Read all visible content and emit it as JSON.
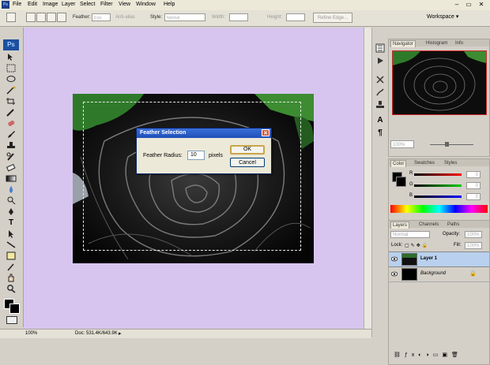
{
  "menubar": {
    "items": [
      "File",
      "Edit",
      "Image",
      "Layer",
      "Select",
      "Filter",
      "View",
      "Window",
      "Help"
    ]
  },
  "options": {
    "feather_label": "Feather:",
    "feather_value": "0 px",
    "antialias_label": "Anti-alias",
    "style_label": "Style:",
    "style_value": "Normal",
    "width_label": "Width:",
    "height_label": "Height:",
    "refine_label": "Refine Edge...",
    "workspace_label": "Workspace"
  },
  "toolbox": {
    "logo": "Ps"
  },
  "dialog": {
    "title": "Feather Selection",
    "radius_label": "Feather Radius:",
    "radius_value": "10",
    "unit": "pixels",
    "ok_label": "OK",
    "cancel_label": "Cancel"
  },
  "navigator": {
    "tabs": [
      "Navigator",
      "Histogram",
      "Info"
    ],
    "zoom": "100%"
  },
  "color_panel": {
    "tabs": [
      "Color",
      "Swatches",
      "Styles"
    ],
    "channels": [
      "R",
      "G",
      "B"
    ],
    "values": [
      "0",
      "0",
      "0"
    ]
  },
  "layers_panel": {
    "tabs": [
      "Layers",
      "Channels",
      "Paths"
    ],
    "blend_mode": "Normal",
    "opacity_label": "Opacity:",
    "opacity_value": "100%",
    "lock_label": "Lock:",
    "fill_label": "Fill:",
    "fill_value": "100%",
    "layers": [
      "Layer 1",
      "Background"
    ]
  },
  "status": {
    "zoom": "100%",
    "doc_info": "Doc: 531.4K/643.9K"
  },
  "colors": {
    "canvas_bg": "#d7c5ef",
    "accent": "#1f4fb8"
  }
}
